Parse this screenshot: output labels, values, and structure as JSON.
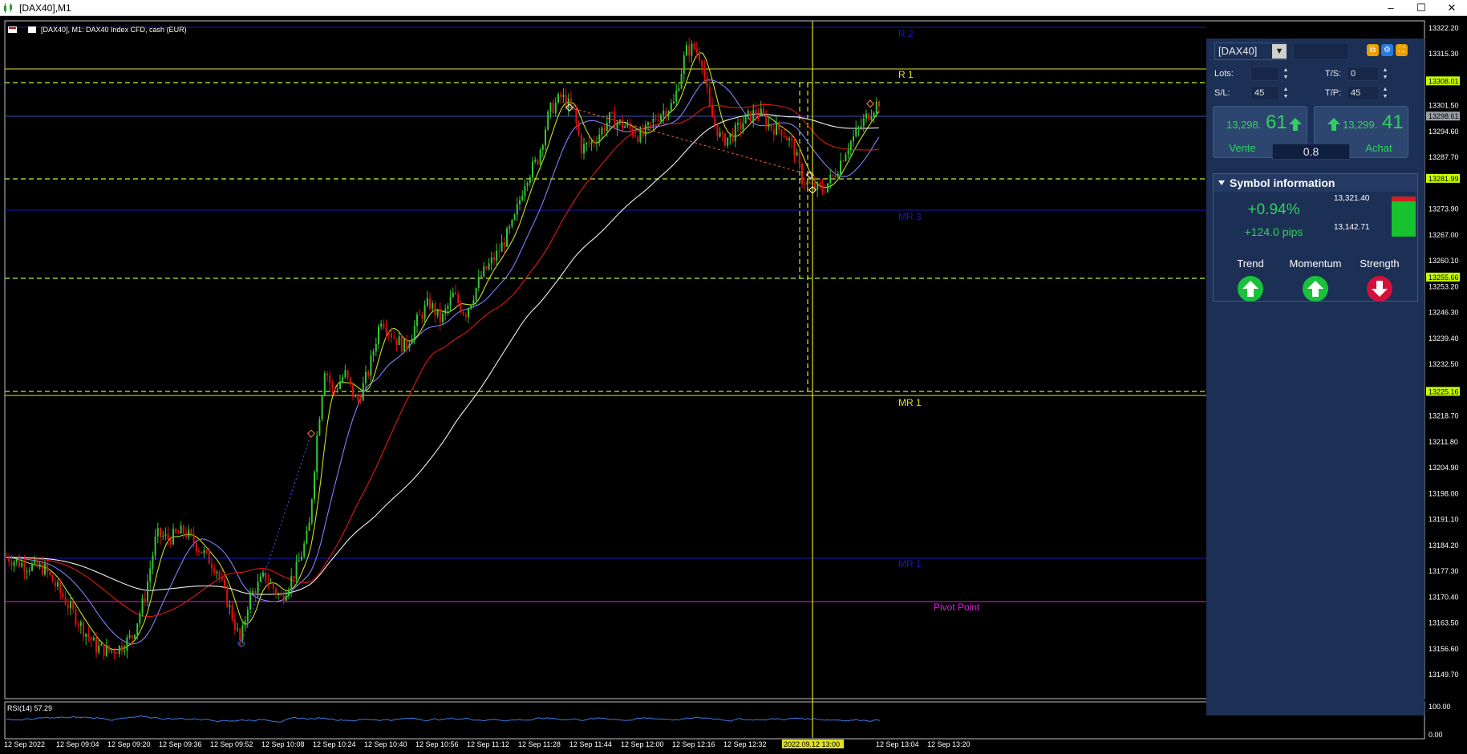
{
  "window": {
    "title": "[DAX40],M1",
    "minimize": "–",
    "maximize": "☐",
    "close": "✕"
  },
  "chart": {
    "info": "[DAX40], M1:  DAX40 Index CFD, cash (EUR)",
    "levels": {
      "r2": "R 2",
      "r1": "R 1",
      "mr3": "MR 3",
      "mr1_upper": "MR 1",
      "mr1_lower": "MR 1",
      "pivot": "Pivot Point"
    },
    "price_scale": [
      "13322.20",
      "13315.30",
      "13308.01",
      "13301.50",
      "13298.61",
      "13294.60",
      "13287.70",
      "13281.99",
      "13273.90",
      "13267.00",
      "13260.10",
      "13255.66",
      "13253.20",
      "13246.30",
      "13239.40",
      "13232.50",
      "13225.16",
      "13218.70",
      "13211.80",
      "13204.90",
      "13198.00",
      "13191.10",
      "13184.20",
      "13177.30",
      "13170.40",
      "13163.50",
      "13156.60",
      "13149.70"
    ],
    "time_axis": [
      "12 Sep 2022",
      "12 Sep 09:04",
      "12 Sep 09:20",
      "12 Sep 09:36",
      "12 Sep 09:52",
      "12 Sep 10:08",
      "12 Sep 10:24",
      "12 Sep 10:40",
      "12 Sep 10:56",
      "12 Sep 11:12",
      "12 Sep 11:28",
      "12 Sep 11:44",
      "12 Sep 12:00",
      "12 Sep 12:16",
      "12 Sep 12:32",
      "12 Sep 13:04",
      "12 Sep 13:20"
    ],
    "time_cursor": "2022.09.12 13:00",
    "rsi_label": "RSI(14) 57.29",
    "rsi_scale_top": "100.00",
    "rsi_scale_bottom": "0.00"
  },
  "panel": {
    "symbol": "[DAX40]",
    "lots_label": "Lots:",
    "lots_value": "",
    "ts_label": "T/S:",
    "ts_value": "0",
    "sl_label": "S/L:",
    "sl_value": "45",
    "tp_label": "T/P:",
    "tp_value": "45",
    "sell_small": "13,298.",
    "sell_big": "61",
    "sell_label": "Vente",
    "buy_small": "13,299.",
    "buy_big": "41",
    "buy_label": "Achat",
    "spread": "0.8",
    "symbol_info_title": "Symbol information",
    "change_pct": "+0.94%",
    "change_pips": "+124.0 pips",
    "high": "13,321.40",
    "low": "13,142.71",
    "trend_label": "Trend",
    "momentum_label": "Momentum",
    "strength_label": "Strength"
  },
  "colors": {
    "up": "#2fd15a",
    "down": "#d2103c",
    "panel_bg": "#1c2f55",
    "candle_up": "#32c832",
    "candle_down": "#e01010"
  }
}
